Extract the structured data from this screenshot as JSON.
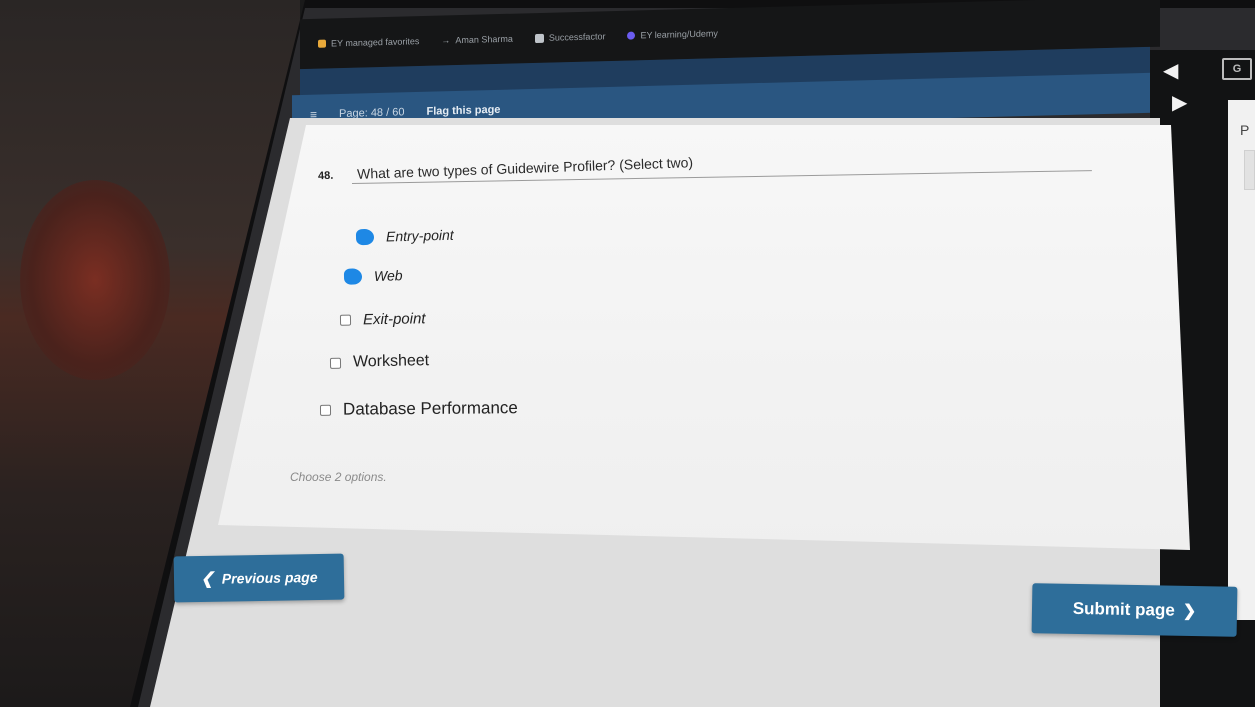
{
  "browser": {
    "bookmarks": [
      {
        "icon": "folder-icon",
        "label": "EY managed favorites"
      },
      {
        "icon": "arrow-icon",
        "label": "Aman Sharma"
      },
      {
        "icon": "bars-icon",
        "label": "Successfactor"
      },
      {
        "icon": "circle-icon",
        "label": "EY learning/Udemy"
      }
    ]
  },
  "header": {
    "menu_icon": "menu-icon",
    "page_indicator": "Page: 48 / 60",
    "flag_label": "Flag this page"
  },
  "question": {
    "number": "48.",
    "text": "What are two types of Guidewire Profiler? (Select two)",
    "options": [
      {
        "label": "Entry-point",
        "checked": true
      },
      {
        "label": "Web",
        "checked": true
      },
      {
        "label": "Exit-point",
        "checked": false
      },
      {
        "label": "Worksheet",
        "checked": false
      },
      {
        "label": "Database Performance",
        "checked": false
      }
    ],
    "hint": "Choose 2 options."
  },
  "nav": {
    "previous_label": "Previous page",
    "submit_label": "Submit page"
  },
  "side_panel": {
    "label": "P",
    "tool_label": "G"
  },
  "colors": {
    "header_blue": "#2a5681",
    "button_blue": "#2e6e9a",
    "checked_blue": "#1e88e5"
  }
}
